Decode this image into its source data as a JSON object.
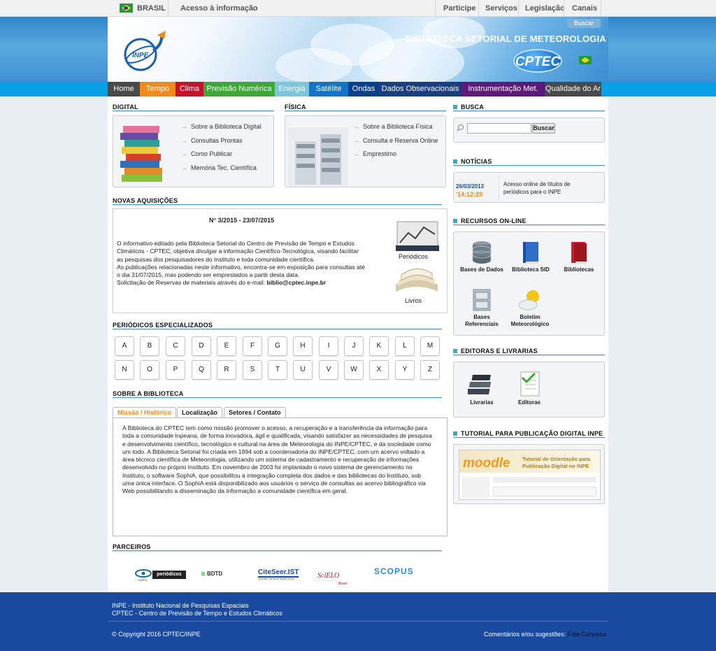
{
  "gov": {
    "country": "BRASIL",
    "access": "Acesso à informação",
    "links": [
      "Participe",
      "Serviços",
      "Legislação",
      "Canais"
    ]
  },
  "header": {
    "title": "BIBLIOTECA SETORIAL DE METEOROLOGIA",
    "search_btn": "Buscar",
    "logo": "INPE",
    "cptec": "CPTEC"
  },
  "menu": [
    {
      "label": "Home",
      "color": "#4a4a4a"
    },
    {
      "label": "Tempo",
      "color": "#f08a1c"
    },
    {
      "label": "Clima",
      "color": "#c8102e"
    },
    {
      "label": "Previsão Numérica",
      "color": "#3aaa35"
    },
    {
      "label": "Energia",
      "color": "#7dc6d9"
    },
    {
      "label": "Satélite",
      "color": "#1174c8"
    },
    {
      "label": "Ondas",
      "color": "#0a3e8f"
    },
    {
      "label": "Dados Observacionais",
      "color": "#1b3d82"
    },
    {
      "label": "Instrumentação Met.",
      "color": "#5e1a7a"
    },
    {
      "label": "Qualidade do Ar",
      "color": "#4a4a4a"
    }
  ],
  "digital": {
    "title": "DIGITAL",
    "links": [
      "Sobre a Biblioteca Digital",
      "Consultas Prontas",
      "Como Publicar",
      "Memória Tec. Científica"
    ]
  },
  "fisica": {
    "title": "FÍSICA",
    "links": [
      "Sobre a Biblioteca Física",
      "Consulta e Reserva Online",
      "Emprestimo"
    ]
  },
  "novas": {
    "title": "NOVAS AQUISIÇÕES",
    "issue": "N° 3/2015 - 23/07/2015",
    "lines": [
      "O informativo editado pela Biblioteca Setorial do Centro de Previsão de Tempo e Estudos",
      "Climáticos - CPTEC, objetiva divulgar a informação Científico-Tecnológica, visando facilitar",
      "as pesquisas dos pesquisadores do Instituto e toda comunidade científica.",
      "As publicações relacionadas neste informativo, encontra-se em exposição para consultas até",
      "o dia 31/07/2015, mas podendo ser emprestados a partir desta data."
    ],
    "reserve_text": "Solicitação de Reservas de materiais através do e-mail: ",
    "reserve_email": "biblio@cptec.inpe.br",
    "periodicos": "Periódicos",
    "livros": "Livros"
  },
  "periodicos": {
    "title": "PERIÓDICOS ESPECIALIZADOS",
    "row1": [
      "A",
      "B",
      "C",
      "D",
      "E",
      "F",
      "G",
      "H",
      "I",
      "J",
      "K",
      "L",
      "M"
    ],
    "row2": [
      "N",
      "O",
      "P",
      "Q",
      "R",
      "S",
      "T",
      "U",
      "V",
      "W",
      "X",
      "Y",
      "Z"
    ]
  },
  "sobre": {
    "title": "SOBRE A BIBLIOTECA",
    "tabs": [
      "Missão / Histórico",
      "Localização",
      "Setores / Contato"
    ],
    "lines": [
      "A Biblioteca do CPTEC tem como missão promover o acesso, a recuperação e a transferência da informação para",
      "toda a comunidade Inpeana, de forma inovadora, ágil e qualificada, visando satisfazer as necessidades de pesquisa",
      "e desenvolvimento científico, tecnológico e cultural na área de Meteorologia do INPE/CPTEC, e da sociedade como",
      "um todo. A Biblioteca Setorial foi criada em 1994 sob a coordenadoria do INPE/CPTEC, com um acervo voltado a",
      "área técnico científica de Meteorologia, utilizando um sistema de cadastramento e recuperação de informações",
      "desenvolvido no próprio Instituto. Em novembro de 2003 foi implantado o novo sistema de gerenciamento no",
      "Instituto, o software SophiA, que possibilitou a integração completa dos dados e das bibliotecas do Instituto, sob",
      "uma única interface. O SophiA está disponibilizado aos usuários o serviço de consultas ao acervo bibliográfico via",
      "Web possibilitando a disseminação da informação a comunidade científica em geral."
    ]
  },
  "parceiros": {
    "title": "PARCEIROS",
    "logos": [
      "periódicos",
      "BDTD",
      "CiteSeer.IST",
      "SciELO",
      "SCOPUS"
    ],
    "capes": "CAPES",
    "scielo_sub": "Brasil",
    "citeseer_sub": "Scientific Literature Digital Library"
  },
  "busca": {
    "title": "BUSCA",
    "button": "Buscar",
    "placeholder": ""
  },
  "noticias": {
    "title": "NOTÍCIAS",
    "date": "26/03/2013",
    "time": "14:12:29",
    "text1": "Acesso online de títulos de",
    "text2": "periódicos para o INPE"
  },
  "recursos": {
    "title": "RECURSOS ON-LINE",
    "items": [
      [
        "Bases de Dados"
      ],
      [
        "Biblioteca SID"
      ],
      [
        "Bibliotecas"
      ],
      [
        "Bases",
        "Referenciais"
      ],
      [
        "Boletim",
        "Meteorológico"
      ]
    ]
  },
  "editoras": {
    "title": "EDITORAS E LIVRARIAS",
    "items": [
      "Livrarias",
      "Editoras"
    ]
  },
  "tutorial": {
    "title": "TUTORIAL PARA PUBLICAÇÃO DIGITAL INPE",
    "brand": "moodle",
    "line1": "Tutorial de Orientação para",
    "line2": "Publicação Digital no INPE"
  },
  "footer": {
    "line1": "INPE - Instituto Nacional de Pesquisas Espaciais",
    "line2": "CPTEC - Centro de Previsão de Tempo e Estudos Climáticos",
    "copyright": "© Copyright 2016 CPTEC/INPE",
    "comment": "Comentários e/ou sugestões: ",
    "contact": "Fale Conosco"
  }
}
